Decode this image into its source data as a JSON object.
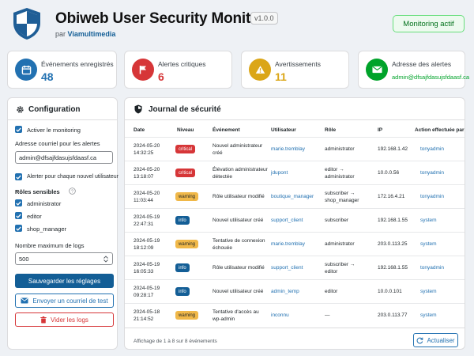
{
  "header": {
    "title": "Obiweb User Security Monitor",
    "version": "v1.0.0",
    "by_prefix": "par",
    "author": "Viamultimedia",
    "status": "Monitoring actif"
  },
  "stats": [
    {
      "label": "Événements enregistrés",
      "value": "48",
      "color": "#2271b1"
    },
    {
      "label": "Alertes critiques",
      "value": "6",
      "color": "#d63638"
    },
    {
      "label": "Avertissements",
      "value": "11",
      "color": "#dba617"
    },
    {
      "label": "Adresse des alertes",
      "value": "admin@dfsajfdasujsfdaasf.ca",
      "color": "#00a32a"
    }
  ],
  "config": {
    "title": "Configuration",
    "enable_monitoring": "Activer le monitoring",
    "email_label": "Adresse courriel pour les alertes",
    "email_value": "admin@dfsajfdasujsfdaasf.ca",
    "alert_new_user": "Alerter pour chaque nouvel utilisateur",
    "roles_title": "Rôles sensibles",
    "roles": [
      "administrator",
      "editor",
      "shop_manager"
    ],
    "max_logs_label": "Nombre maximum de logs",
    "max_logs_value": "500",
    "save_button": "Sauvegarder les réglages",
    "test_button": "Envoyer un courriel de test",
    "clear_button": "Vider les logs"
  },
  "journal": {
    "title": "Journal de sécurité",
    "columns": [
      "Date",
      "Niveau",
      "Événement",
      "Utilisateur",
      "Rôle",
      "IP",
      "Action effectuée par"
    ],
    "rows": [
      {
        "date": "2024-05-20",
        "time": "14:32:25",
        "level": "critical",
        "event": [
          "Nouvel administrateur",
          "créé"
        ],
        "user": "marie.tremblay",
        "role": [
          "administrator"
        ],
        "ip": "192.168.1.42",
        "by": "tonyadmin"
      },
      {
        "date": "2024-05-20",
        "time": "13:18:07",
        "level": "critical",
        "event": [
          "Élévation administrateur",
          "détectée"
        ],
        "user": "jdupont",
        "role": [
          "editor →",
          "administrator"
        ],
        "ip": "10.0.0.56",
        "by": "tonyadmin"
      },
      {
        "date": "2024-05-20",
        "time": "11:03:44",
        "level": "warning",
        "event": [
          "Rôle utilisateur modifié"
        ],
        "user": "boutique_manager",
        "role": [
          "subscriber →",
          "shop_manager"
        ],
        "ip": "172.16.4.21",
        "by": "tonyadmin"
      },
      {
        "date": "2024-05-19",
        "time": "22:47:31",
        "level": "info",
        "event": [
          "Nouvel utilisateur créé"
        ],
        "user": "support_client",
        "role": [
          "subscriber"
        ],
        "ip": "192.168.1.55",
        "by": "system"
      },
      {
        "date": "2024-05-19",
        "time": "18:12:09",
        "level": "warning",
        "event": [
          "Tentative de connexion",
          "échouée"
        ],
        "user": "marie.tremblay",
        "role": [
          "administrator"
        ],
        "ip": "203.0.113.25",
        "by": "system"
      },
      {
        "date": "2024-05-19",
        "time": "16:05:33",
        "level": "info",
        "event": [
          "Rôle utilisateur modifié"
        ],
        "user": "support_client",
        "role": [
          "subscriber →",
          "editor"
        ],
        "ip": "192.168.1.55",
        "by": "tonyadmin"
      },
      {
        "date": "2024-05-19",
        "time": "09:28:17",
        "level": "info",
        "event": [
          "Nouvel utilisateur créé"
        ],
        "user": "admin_temp",
        "role": [
          "editor"
        ],
        "ip": "10.0.0.101",
        "by": "system"
      },
      {
        "date": "2024-05-18",
        "time": "21:14:52",
        "level": "warning",
        "event": [
          "Tentative d'accès au",
          "wp-admin"
        ],
        "user": "inconnu",
        "role": [
          "—"
        ],
        "ip": "203.0.113.77",
        "by": "system"
      }
    ],
    "footer": "Affichage de 1 à 8 sur 8 événements",
    "refresh": "Actualiser"
  }
}
